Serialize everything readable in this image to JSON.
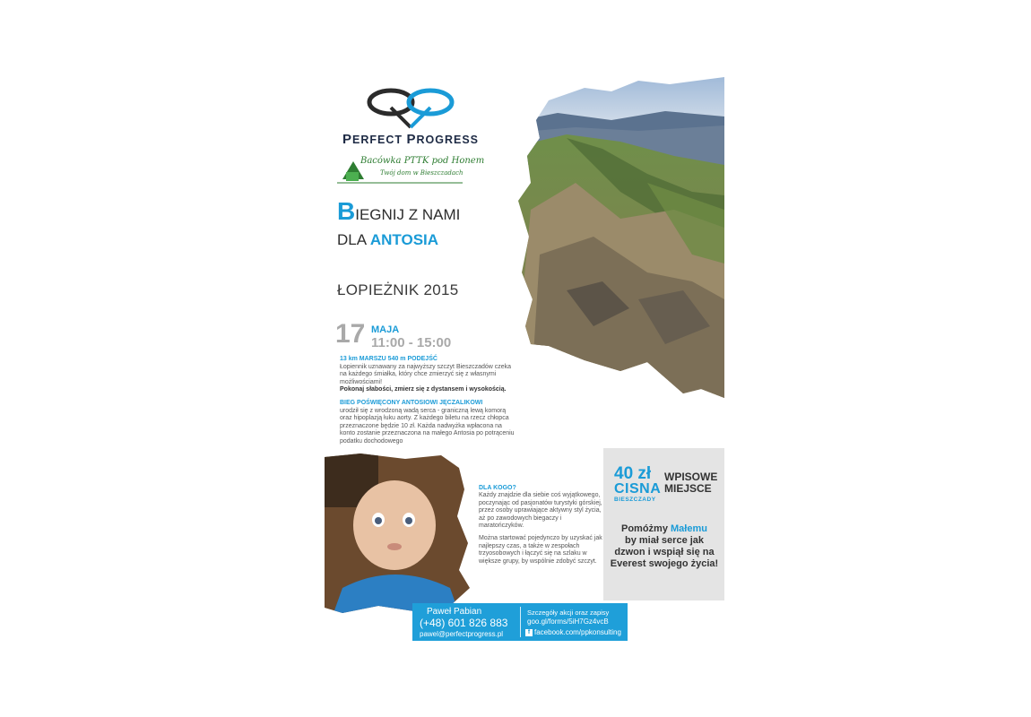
{
  "brand": {
    "first": "P",
    "rest1": "ERFECT ",
    "first2": "P",
    "rest2": "ROGRESS"
  },
  "pttk": {
    "title": "Bacówka PTTK pod Honem",
    "subtitle": "Twój dom w Bieszczadach"
  },
  "headline": {
    "b": "B",
    "line1_rest": "IEGNIJ Z NAMI",
    "line2_pre": "DLA ",
    "line2_accent": "ANTOSIA"
  },
  "event": {
    "name": "ŁOPIEŻNIK 2015"
  },
  "date": {
    "day": "17",
    "month": "MAJA",
    "time": "11:00 - 15:00"
  },
  "block1": {
    "head": "13 km MARSZU 540 m PODEJŚĆ",
    "body": "Łopiennik uznawany za najwyższy szczyt Bieszczadów czeka na każdego śmiałka, który chce zmierzyć się z własnymi możliwościami!",
    "bold": "Pokonaj słabości, zmierz się z dystansem i wysokością."
  },
  "block2": {
    "head": "BIEG POŚWIĘCONY ANTOSIOWI JĘCZALIKOWI",
    "body": "urodził się z wrodzoną wadą serca - graniczną lewą komorą oraz hipoplazją łuku aorty. Z każdego biletu na rzecz chłopca przeznaczone będzie 10 zł. Każda nadwyżka wpłacona na konto zostanie przeznaczona na małego Antosia po potrąceniu podatku dochodowego"
  },
  "who": {
    "head": "DLA KOGO?",
    "p1": "Każdy znajdzie dla siebie coś wyjątkowego, poczynając od pasjonatów turystyki górskiej, przez osoby uprawiające aktywny styl życia, aż po zawodowych biegaczy i maratończyków.",
    "p2": "Można startować pojedynczo by uzyskać jak najlepszy czas, a także w zespołach trzyosobowych i łączyć się na szlaku w większe grupy, by wspólnie zdobyć szczyt."
  },
  "info": {
    "price": "40 zł",
    "price_label": "WPISOWE",
    "place": "CISNA",
    "place_sub": "BIESZCZADY",
    "place_label": "MIEJSCE",
    "appeal_pre": "Pomóżmy ",
    "appeal_accent": "Małemu",
    "appeal_rest": "by miał serce jak dzwon i wspiął się na Everest swojego życia!"
  },
  "contact": {
    "name": "Paweł Pabian",
    "phone": "(+48) 601 826 883",
    "email": "pawel@perfectprogress.pl",
    "signup_label": "Szczegóły akcji oraz zapisy",
    "form_url": "goo.gl/forms/5iH7Gz4vcB",
    "fb_icon": "f",
    "facebook": "facebook.com/ppkonsulting"
  },
  "colors": {
    "accent": "#1a9bd7",
    "contact_bg": "#1f9fd9",
    "grey_box": "#e4e4e4"
  },
  "icons": {
    "logo": "pp-butterfly-logo",
    "pttk": "pttk-hut-logo",
    "fb": "facebook-icon"
  }
}
